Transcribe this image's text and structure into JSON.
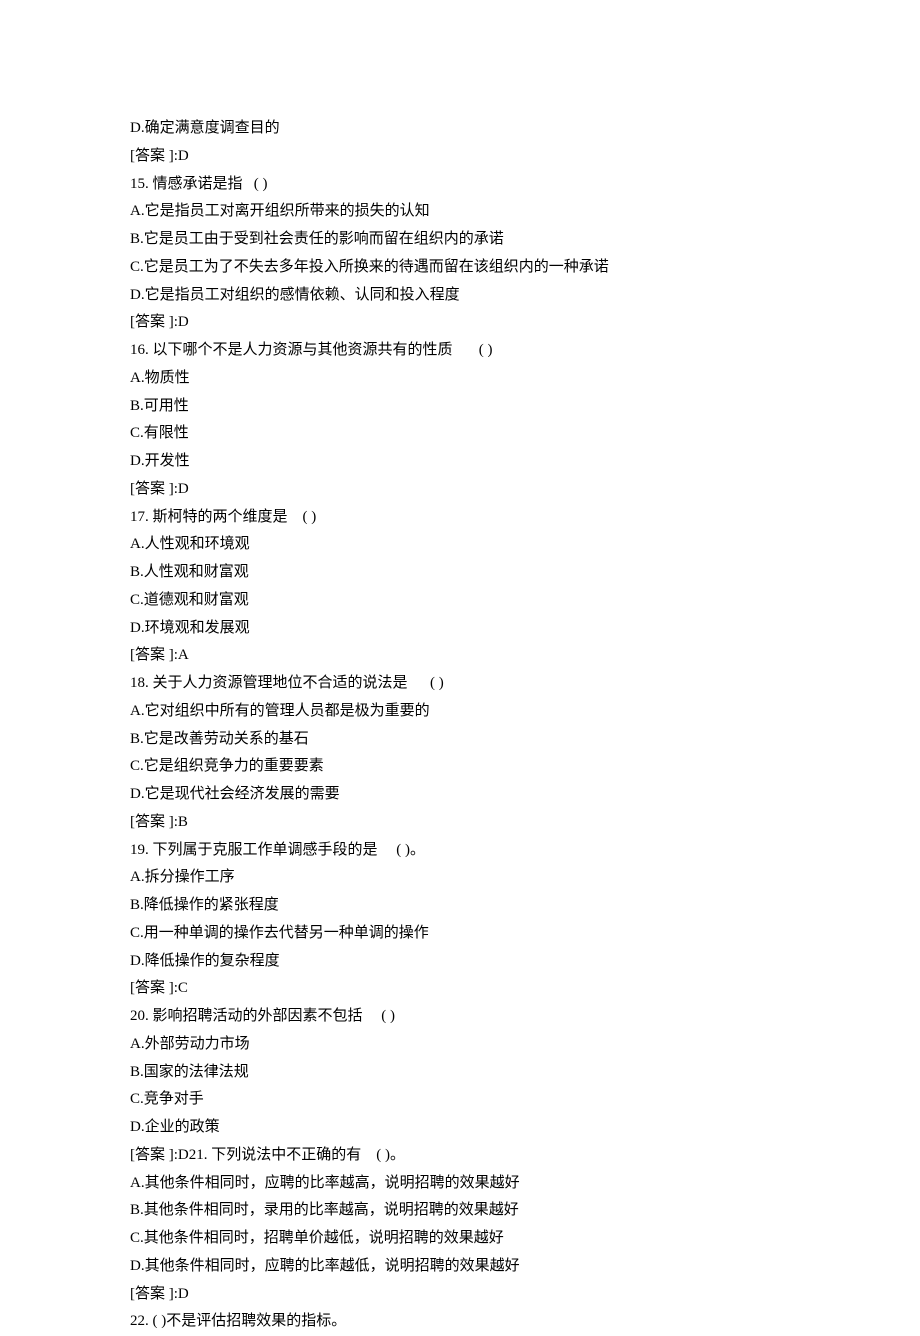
{
  "lines": [
    "D.确定满意度调查目的",
    "[答案 ]:D",
    "15. 情感承诺是指   ( )",
    "A.它是指员工对离开组织所带来的损失的认知",
    "B.它是员工由于受到社会责任的影响而留在组织内的承诺",
    "C.它是员工为了不失去多年投入所换来的待遇而留在该组织内的一种承诺",
    "D.它是指员工对组织的感情依赖、认同和投入程度",
    "[答案 ]:D",
    "16. 以下哪个不是人力资源与其他资源共有的性质       ( )",
    "A.物质性",
    "B.可用性",
    "C.有限性",
    "D.开发性",
    "[答案 ]:D",
    "17. 斯柯特的两个维度是    ( )",
    "A.人性观和环境观",
    "B.人性观和财富观",
    "C.道德观和财富观",
    "D.环境观和发展观",
    "[答案 ]:A",
    "18. 关于人力资源管理地位不合适的说法是      ( )",
    "A.它对组织中所有的管理人员都是极为重要的",
    "B.它是改善劳动关系的基石",
    "C.它是组织竞争力的重要要素",
    "D.它是现代社会经济发展的需要",
    "[答案 ]:B",
    "19. 下列属于克服工作单调感手段的是     ( )。",
    "A.拆分操作工序",
    "B.降低操作的紧张程度",
    "C.用一种单调的操作去代替另一种单调的操作",
    "D.降低操作的复杂程度",
    "[答案 ]:C",
    "20. 影响招聘活动的外部因素不包括     ( )",
    "A.外部劳动力市场",
    "B.国家的法律法规",
    "C.竞争对手",
    "D.企业的政策",
    "[答案 ]:D21. 下列说法中不正确的有    ( )。",
    "A.其他条件相同时，应聘的比率越高，说明招聘的效果越好",
    "B.其他条件相同时，录用的比率越高，说明招聘的效果越好",
    "C.其他条件相同时，招聘单价越低，说明招聘的效果越好",
    "D.其他条件相同时，应聘的比率越低，说明招聘的效果越好",
    "[答案 ]:D",
    "22. ( )不是评估招聘效果的指标。"
  ]
}
